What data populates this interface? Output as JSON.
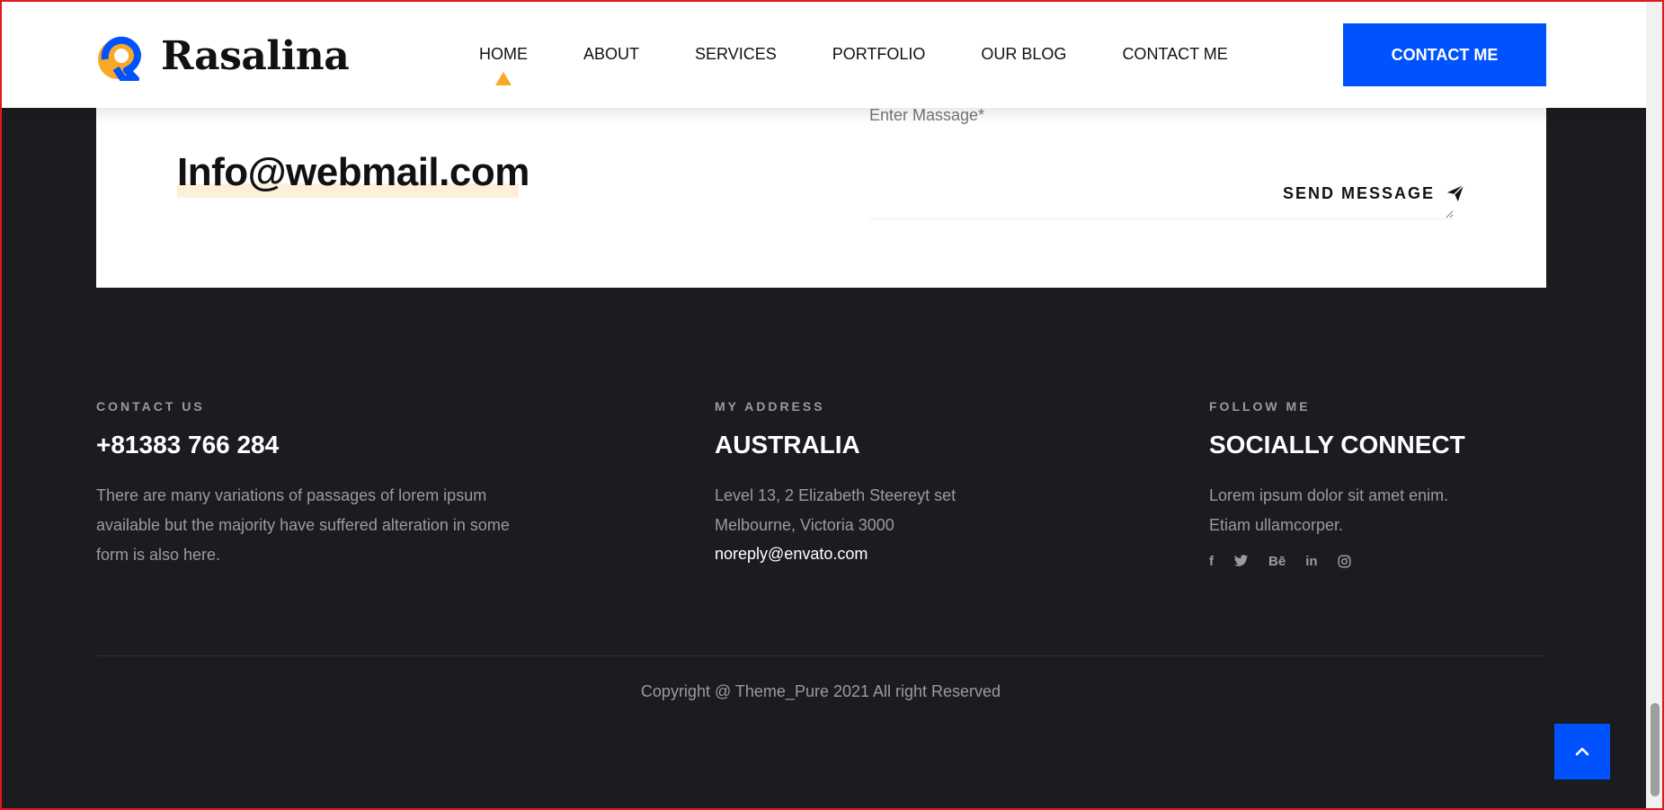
{
  "header": {
    "logo_text": "Rasalina",
    "nav": [
      {
        "label": "HOME",
        "active": true
      },
      {
        "label": "ABOUT"
      },
      {
        "label": "SERVICES"
      },
      {
        "label": "PORTFOLIO"
      },
      {
        "label": "OUR BLOG"
      },
      {
        "label": "CONTACT ME"
      }
    ],
    "cta_label": "CONTACT ME"
  },
  "contact_card": {
    "partial_text": "the majority have suffered alteration in some form",
    "email": "Info@webmail.com",
    "message_label": "Enter Massage*",
    "send_label": "SEND MESSAGE",
    "send_icon": "paper-plane-icon"
  },
  "footer": {
    "contact": {
      "eyebrow": "CONTACT US",
      "title": "+81383 766 284",
      "text": "There are many variations of passages of lorem ipsum available but the majority have suffered alteration in some form is also here."
    },
    "address": {
      "eyebrow": "MY ADDRESS",
      "title": "AUSTRALIA",
      "line1": "Level 13, 2 Elizabeth Steereyt set",
      "line2": "Melbourne, Victoria 3000",
      "email": "noreply@envato.com"
    },
    "follow": {
      "eyebrow": "FOLLOW ME",
      "title": "SOCIALLY CONNECT",
      "text": "Lorem ipsum dolor sit amet enim. Etiam ullamcorper.",
      "socials": [
        {
          "icon": "facebook-icon",
          "glyph": "f"
        },
        {
          "icon": "twitter-icon",
          "glyph": ""
        },
        {
          "icon": "behance-icon",
          "glyph": "Bē"
        },
        {
          "icon": "linkedin-icon",
          "glyph": "in"
        },
        {
          "icon": "instagram-icon",
          "glyph": ""
        }
      ]
    },
    "copyright": "Copyright @ Theme_Pure 2021 All right Reserved"
  },
  "colors": {
    "accent_blue": "#0052ff",
    "accent_orange": "#f8a826",
    "footer_bg": "#1b1c20",
    "muted_text": "#9a9ba0"
  }
}
